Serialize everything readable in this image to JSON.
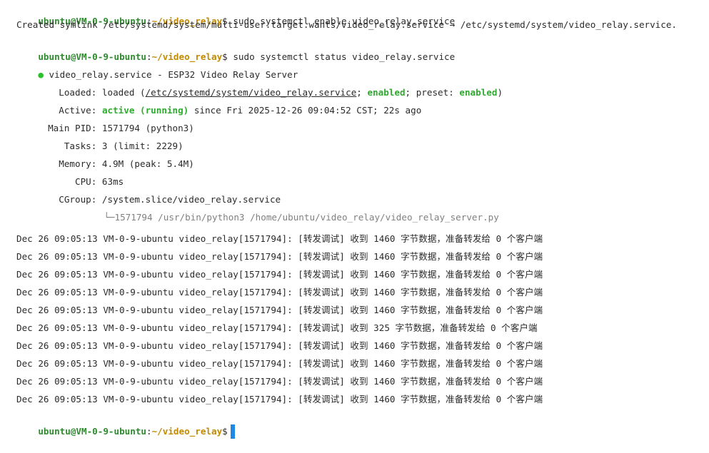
{
  "prompt": {
    "user_host": "ubuntu@VM-0-9-ubuntu",
    "colon": ":",
    "path": "~/video_relay",
    "dollar": "$"
  },
  "commands": {
    "enable": " sudo systemctl enable video_relay.service",
    "status": " sudo systemctl status video_relay.service"
  },
  "symlink_output": "Created symlink /etc/systemd/system/multi-user.target.wants/video_relay.service → /etc/systemd/system/video_relay.service.",
  "status": {
    "bullet": "●",
    "header": " video_relay.service - ESP32 Video Relay Server",
    "loaded_label": "Loaded:",
    "loaded_pre": " loaded (",
    "loaded_path": "/etc/systemd/system/video_relay.service",
    "loaded_sep": "; ",
    "loaded_enabled": "enabled",
    "loaded_preset": "; preset: ",
    "loaded_preset_value": "enabled",
    "loaded_close": ")",
    "active_label": "Active:",
    "active_state": "active (running)",
    "active_since": " since Fri 2025-12-26 09:04:52 CST; 22s ago",
    "mainpid_label": "Main PID:",
    "mainpid_value": " 1571794 (python3)",
    "tasks_label": "Tasks:",
    "tasks_value": " 3 (limit: 2229)",
    "memory_label": "Memory:",
    "memory_value": " 4.9M (peak: 5.4M)",
    "cpu_label": "CPU:",
    "cpu_value": " 63ms",
    "cgroup_label": "CGroup:",
    "cgroup_value": " /system.slice/video_relay.service",
    "tree_glyph": "└─",
    "process_line": "1571794 /usr/bin/python3 /home/ubuntu/video_relay/video_relay_server.py"
  },
  "log_lines": [
    "Dec 26 09:05:13 VM-0-9-ubuntu video_relay[1571794]: [转发调试] 收到 1460 字节数据，准备转发给 0 个客户端",
    "Dec 26 09:05:13 VM-0-9-ubuntu video_relay[1571794]: [转发调试] 收到 1460 字节数据，准备转发给 0 个客户端",
    "Dec 26 09:05:13 VM-0-9-ubuntu video_relay[1571794]: [转发调试] 收到 1460 字节数据，准备转发给 0 个客户端",
    "Dec 26 09:05:13 VM-0-9-ubuntu video_relay[1571794]: [转发调试] 收到 1460 字节数据，准备转发给 0 个客户端",
    "Dec 26 09:05:13 VM-0-9-ubuntu video_relay[1571794]: [转发调试] 收到 1460 字节数据，准备转发给 0 个客户端",
    "Dec 26 09:05:13 VM-0-9-ubuntu video_relay[1571794]: [转发调试] 收到 325 字节数据，准备转发给 0 个客户端",
    "Dec 26 09:05:13 VM-0-9-ubuntu video_relay[1571794]: [转发调试] 收到 1460 字节数据，准备转发给 0 个客户端",
    "Dec 26 09:05:13 VM-0-9-ubuntu video_relay[1571794]: [转发调试] 收到 1460 字节数据，准备转发给 0 个客户端",
    "Dec 26 09:05:13 VM-0-9-ubuntu video_relay[1571794]: [转发调试] 收到 1460 字节数据，准备转发给 0 个客户端",
    "Dec 26 09:05:13 VM-0-9-ubuntu video_relay[1571794]: [转发调试] 收到 1460 字节数据，准备转发给 0 个客户端"
  ],
  "colors": {
    "prompt_user": "#2e8b2e",
    "prompt_path": "#c18a00",
    "active_green": "#2faa2f",
    "cursor": "#1e88e5"
  }
}
